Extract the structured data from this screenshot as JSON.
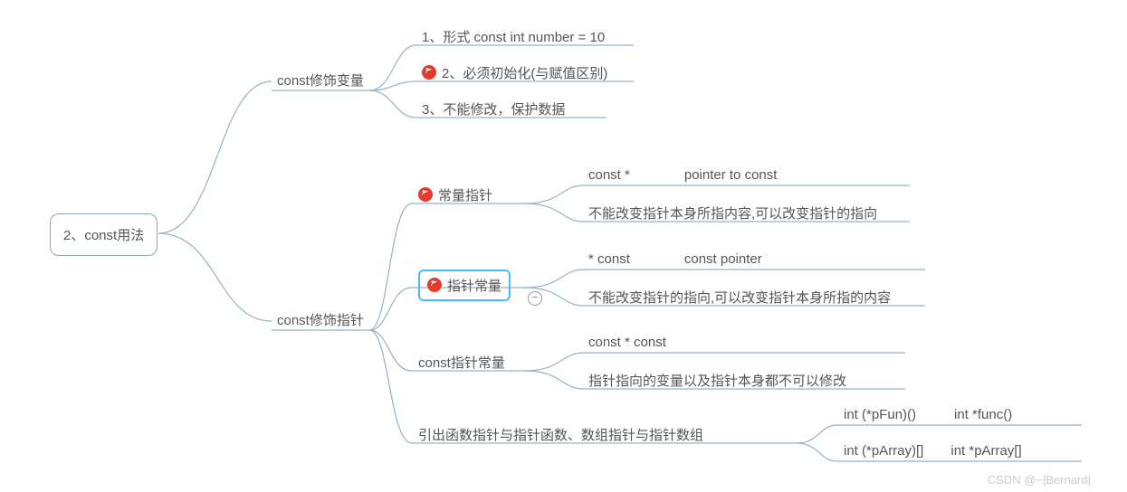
{
  "root": "2、const用法",
  "branches": {
    "b1": {
      "label": "const修饰变量",
      "children": {
        "c1": "1、形式 const int number = 10",
        "c2": "2、必须初始化(与赋值区别)",
        "c3": "3、不能修改，保护数据"
      }
    },
    "b2": {
      "label": "const修饰指针",
      "children": {
        "p1": {
          "label": "常量指针",
          "row1a": "const *",
          "row1b": "pointer to const",
          "row2": "不能改变指针本身所指内容,可以改变指针的指向"
        },
        "p2": {
          "label": "指针常量",
          "row1a": "* const",
          "row1b": "const pointer",
          "row2": "不能改变指针的指向,可以改变指针本身所指的内容"
        },
        "p3": {
          "label": "const指针常量",
          "row1": "const * const",
          "row2": "指针指向的变量以及指针本身都不可以修改"
        },
        "p4": {
          "label": "引出函数指针与指针函数、数组指针与指针数组",
          "row1a": "int (*pFun)()",
          "row1b": "int *func()",
          "row2a": "int (*pArray)[]",
          "row2b": "int *pArray[]"
        }
      }
    }
  },
  "watermark": "CSDN @~|Bernard|"
}
